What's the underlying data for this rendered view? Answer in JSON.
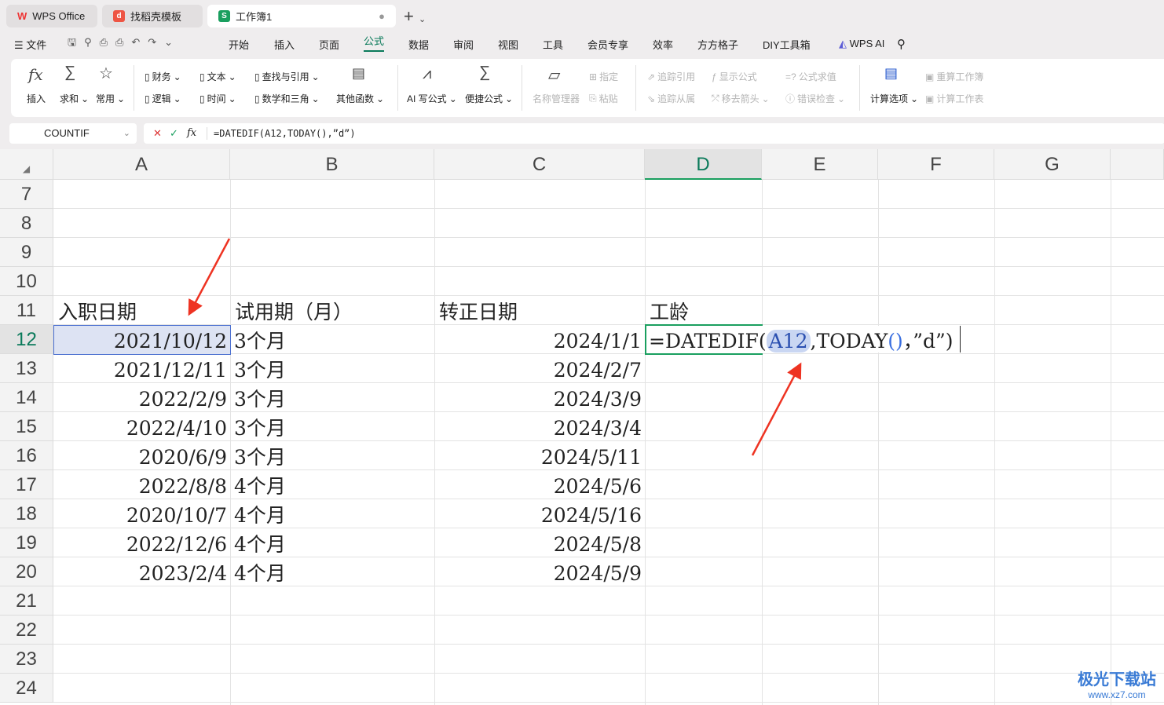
{
  "tabs": [
    {
      "label": "WPS Office"
    },
    {
      "label": "找稻壳模板"
    },
    {
      "label": "工作簿1"
    }
  ],
  "menu": {
    "file": "文件",
    "items": [
      "开始",
      "插入",
      "页面",
      "公式",
      "数据",
      "审阅",
      "视图",
      "工具",
      "会员专享",
      "效率",
      "方方格子",
      "DIY工具箱"
    ],
    "wps_ai": "WPS AI",
    "active": "公式"
  },
  "ribbon": {
    "insert": "插入",
    "sum": "求和",
    "common": "常用",
    "finance": "财务",
    "text": "文本",
    "lookup": "查找与引用",
    "logic": "逻辑",
    "time": "时间",
    "math": "数学和三角",
    "other": "其他函数",
    "ai_formula": "AI 写公式",
    "quick_formula": "便捷公式",
    "name_mgr": "名称管理器",
    "assign": "指定",
    "paste": "粘贴",
    "trace_prec": "追踪引用",
    "trace_dep": "追踪从属",
    "show_formula": "显示公式",
    "remove_arrows": "移去箭头",
    "eval_formula": "公式求值",
    "error_check": "错误检查",
    "calc_options": "计算选项",
    "recalc_book": "重算工作簿",
    "calc_sheet": "计算工作表"
  },
  "namebox": "COUNTIF",
  "formula": "=DATEDIF(A12,TODAY(),”d”)",
  "columns": [
    "A",
    "B",
    "C",
    "D",
    "E",
    "F",
    "G"
  ],
  "rows": [
    "7",
    "8",
    "9",
    "10",
    "11",
    "12",
    "13",
    "14",
    "15",
    "16",
    "17",
    "18",
    "19",
    "20",
    "21",
    "22",
    "23",
    "24"
  ],
  "headers": {
    "a": "入职日期",
    "b": "试用期（月）",
    "c": "转正日期",
    "d": "工龄"
  },
  "data": [
    {
      "a": "2021/10/12",
      "b": "3个月",
      "c": "2024/1/1"
    },
    {
      "a": "2021/12/11",
      "b": "3个月",
      "c": "2024/2/7"
    },
    {
      "a": "2022/2/9",
      "b": "3个月",
      "c": "2024/3/9"
    },
    {
      "a": "2022/4/10",
      "b": "3个月",
      "c": "2024/3/4"
    },
    {
      "a": "2020/6/9",
      "b": "3个月",
      "c": "2024/5/11"
    },
    {
      "a": "2022/8/8",
      "b": "4个月",
      "c": "2024/5/6"
    },
    {
      "a": "2020/10/7",
      "b": "4个月",
      "c": "2024/5/16"
    },
    {
      "a": "2022/12/6",
      "b": "4个月",
      "c": "2024/5/8"
    },
    {
      "a": "2023/2/4",
      "b": "4个月",
      "c": "2024/5/9"
    }
  ],
  "edit": {
    "p1": "=DATEDIF(",
    "ref": "A12",
    "p2": ",TODAY",
    "p3": "()",
    "p4": "，”d”)"
  },
  "watermark": {
    "name": "极光下载站",
    "url": "www.xz7.com"
  }
}
